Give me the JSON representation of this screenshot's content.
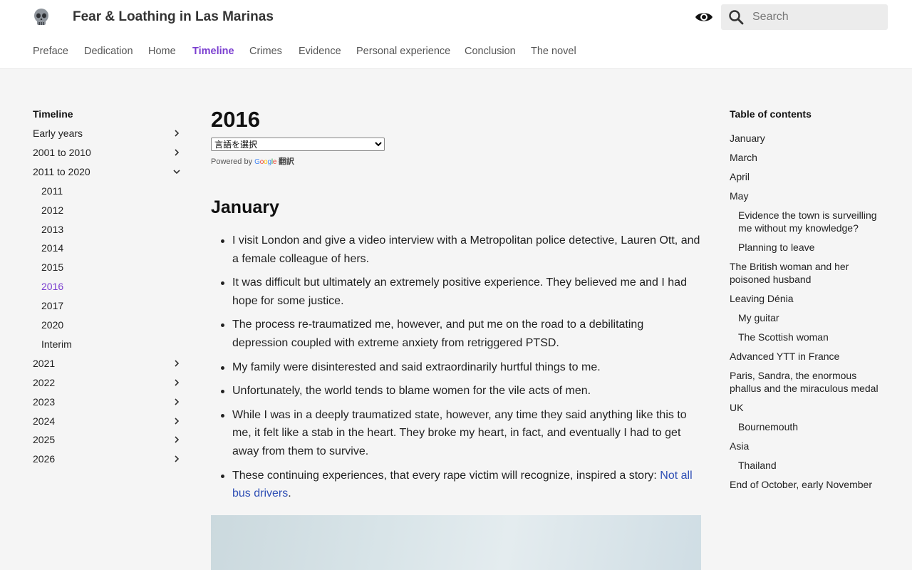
{
  "header": {
    "site_title": "Fear & Loathing in Las Marinas",
    "logo_icon": "skull-icon",
    "theme_icon": "eye-icon",
    "search_placeholder": "Search"
  },
  "nav": [
    {
      "label": "Preface",
      "active": false
    },
    {
      "label": "Dedication",
      "active": false
    },
    {
      "label": "Home",
      "active": false
    },
    {
      "label": "Timeline",
      "active": true
    },
    {
      "label": "Crimes",
      "active": false
    },
    {
      "label": "Evidence",
      "active": false
    },
    {
      "label": "Personal experience",
      "active": false
    },
    {
      "label": "Conclusion",
      "active": false
    },
    {
      "label": "The novel",
      "active": false
    }
  ],
  "sidebar": {
    "title": "Timeline",
    "items": [
      {
        "label": "Early years",
        "chevron": "right"
      },
      {
        "label": "2001 to 2010",
        "chevron": "right"
      },
      {
        "label": "2011 to 2020",
        "chevron": "down"
      },
      {
        "label": "2011",
        "sub": true
      },
      {
        "label": "2012",
        "sub": true
      },
      {
        "label": "2013",
        "sub": true
      },
      {
        "label": "2014",
        "sub": true
      },
      {
        "label": "2015",
        "sub": true
      },
      {
        "label": "2016",
        "sub": true,
        "current": true
      },
      {
        "label": "2017",
        "sub": true
      },
      {
        "label": "2020",
        "sub": true
      },
      {
        "label": "Interim",
        "sub": true
      },
      {
        "label": "2021",
        "chevron": "right"
      },
      {
        "label": "2022",
        "chevron": "right"
      },
      {
        "label": "2023",
        "chevron": "right"
      },
      {
        "label": "2024",
        "chevron": "right"
      },
      {
        "label": "2025",
        "chevron": "right"
      },
      {
        "label": "2026",
        "chevron": "right"
      }
    ]
  },
  "main": {
    "title": "2016",
    "language_select": "言語を選択",
    "powered_by": "Powered by",
    "google_label": "Google",
    "translate_label": "翻訳",
    "section_title": "January",
    "bullets": [
      "I visit London and give a video interview with a Metropolitan police detective, Lauren Ott, and a female colleague of hers.",
      "It was difficult but ultimately an extremely positive experience. They believed me and I had hope for some justice.",
      "The process re-traumatized me, however, and put me on the road to a debilitating depression coupled with extreme anxiety from retriggered PTSD.",
      "My family were disinterested and said extraordinarily hurtful things to me.",
      "Unfortunately, the world tends to blame women for the vile acts of men.",
      "While I was in a deeply traumatized state, however, any time they said anything like this to me, it felt like a stab in the heart. They broke my heart, in fact, and eventually I had to get away from them to survive."
    ],
    "last_bullet_text": "These continuing experiences, that every rape victim will recognize, inspired a story: ",
    "last_bullet_link": "Not all bus drivers",
    "last_bullet_end": "."
  },
  "toc": {
    "title": "Table of contents",
    "items": [
      {
        "label": "January"
      },
      {
        "label": "March"
      },
      {
        "label": "April"
      },
      {
        "label": "May"
      },
      {
        "label": "Evidence the town is surveilling me without my knowledge?",
        "sub": true
      },
      {
        "label": "Planning to leave",
        "sub": true
      },
      {
        "label": "The British woman and her poisoned husband"
      },
      {
        "label": "Leaving Dénia"
      },
      {
        "label": "My guitar",
        "sub": true
      },
      {
        "label": "The Scottish woman",
        "sub": true
      },
      {
        "label": "Advanced YTT in France"
      },
      {
        "label": "Paris, Sandra, the enormous phallus and the miraculous medal"
      },
      {
        "label": "UK"
      },
      {
        "label": "Bournemouth",
        "sub": true
      },
      {
        "label": "Asia"
      },
      {
        "label": "Thailand",
        "sub": true
      },
      {
        "label": "End of October, early November"
      }
    ]
  },
  "colors": {
    "accent": "#7b3fd0",
    "link": "#2f4fb5",
    "background": "#f5f5f5",
    "header_bg": "#ffffff"
  }
}
